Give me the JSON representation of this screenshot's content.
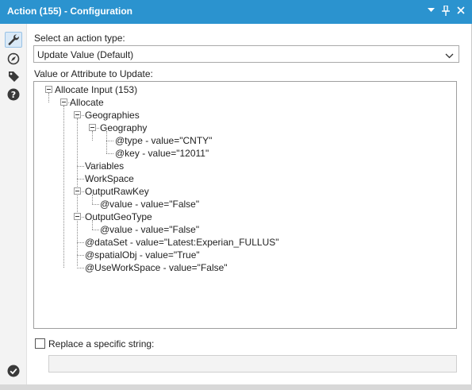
{
  "window": {
    "title": "Action (155) - Configuration"
  },
  "title_controls": [
    {
      "name": "dropdown-arrow-icon",
      "glyph": "▾"
    },
    {
      "name": "pin-icon",
      "glyph": "pin"
    },
    {
      "name": "close-icon",
      "glyph": "✕"
    }
  ],
  "sidebar": {
    "items": [
      {
        "name": "configuration-wrench-icon",
        "active": true
      },
      {
        "name": "layout-navigation-icon",
        "active": false
      },
      {
        "name": "annotation-tag-icon",
        "active": false
      },
      {
        "name": "help-icon",
        "active": false
      }
    ],
    "status_icon": "checkmark-icon"
  },
  "action_type": {
    "label": "Select an action type:",
    "selected": "Update Value (Default)"
  },
  "tree": {
    "label": "Value or Attribute to Update:",
    "nodes": [
      {
        "text": "Allocate Input (153)"
      },
      {
        "text": "Allocate"
      },
      {
        "text": "Geographies"
      },
      {
        "text": "Geography"
      },
      {
        "text": "@type - value=\"CNTY\""
      },
      {
        "text": "@key - value=\"12011\""
      },
      {
        "text": "Variables"
      },
      {
        "text": "WorkSpace"
      },
      {
        "text": "OutputRawKey"
      },
      {
        "text": "@value - value=\"False\""
      },
      {
        "text": "OutputGeoType"
      },
      {
        "text": "@value - value=\"False\""
      },
      {
        "text": "@dataSet - value=\"Latest:Experian_FULLUS\""
      },
      {
        "text": "@spatialObj - value=\"True\""
      },
      {
        "text": "@UseWorkSpace - value=\"False\""
      }
    ]
  },
  "replace": {
    "label": "Replace a specific string:",
    "checked": false,
    "value": ""
  },
  "colors": {
    "titlebar": "#2b93cf",
    "accent": "#2b93cf"
  }
}
